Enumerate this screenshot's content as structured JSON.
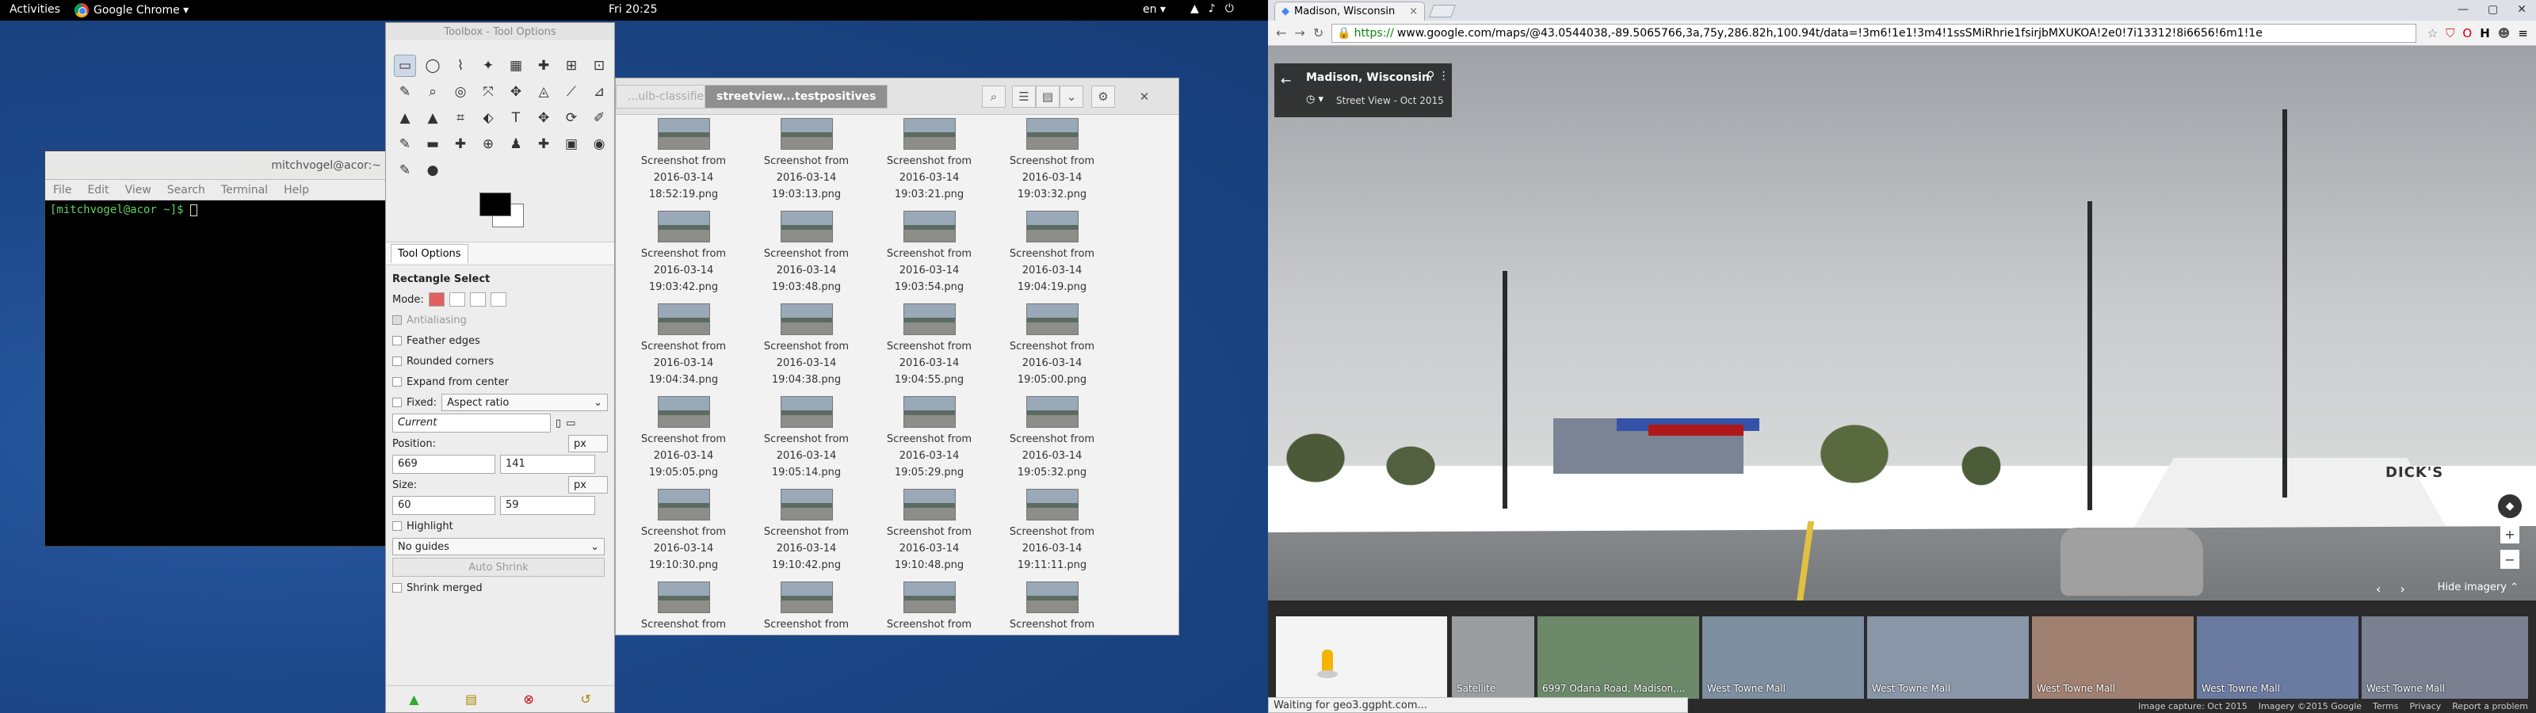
{
  "topbar": {
    "activities": "Activities",
    "app": "Google Chrome ▾",
    "clock": "Fri 20:25",
    "lang": "en ▾",
    "tray_icons": [
      "▲",
      "♪",
      "⏻"
    ]
  },
  "terminal": {
    "title": "mitchvogel@acor:~",
    "menu": [
      "File",
      "Edit",
      "View",
      "Search",
      "Terminal",
      "Help"
    ],
    "prompt": "[mitchvogel@acor ~]$ "
  },
  "toolbox": {
    "title": "Toolbox - Tool Options",
    "tools": [
      "▭",
      "◯",
      "⌇",
      "✦",
      "▦",
      "✚",
      "⊞",
      "⊡",
      "✎",
      "⌕",
      "◎",
      "⤧",
      "✥",
      "◬",
      "⟋",
      "⊿",
      "▲",
      "▲",
      "⌗",
      "⬖",
      "T",
      "✥",
      "⟳",
      "✐",
      "✎",
      "▬",
      "✚",
      "⊕",
      "♟",
      "✚",
      "▣",
      "◉",
      "✎",
      "●"
    ],
    "tab_label": "Tool Options",
    "tool_name": "Rectangle Select",
    "mode_label": "Mode:",
    "antialiasing": "Antialiasing",
    "feather": "Feather edges",
    "rounded": "Rounded corners",
    "expand": "Expand from center",
    "fixed": "Fixed:",
    "fixed_value": "Aspect ratio",
    "current": "Current",
    "position_label": "Position:",
    "unit": "px",
    "pos_x": "669",
    "pos_y": "141",
    "size_label": "Size:",
    "size_w": "60",
    "size_h": "59",
    "highlight": "Highlight",
    "guides": "No guides",
    "auto_shrink": "Auto Shrink",
    "shrink_merged": "Shrink merged"
  },
  "files": {
    "crumb_prev": "...ulb-classifier",
    "crumb_active": "streetview...testpositives",
    "items": [
      {
        "l1": "Screenshot from",
        "l2": "2016-03-14",
        "l3": "18:52:19.png"
      },
      {
        "l1": "Screenshot from",
        "l2": "2016-03-14",
        "l3": "19:03:13.png"
      },
      {
        "l1": "Screenshot from",
        "l2": "2016-03-14",
        "l3": "19:03:21.png"
      },
      {
        "l1": "Screenshot from",
        "l2": "2016-03-14",
        "l3": "19:03:32.png"
      },
      {
        "l1": "Screenshot from",
        "l2": "2016-03-14",
        "l3": "19:03:42.png"
      },
      {
        "l1": "Screenshot from",
        "l2": "2016-03-14",
        "l3": "19:03:48.png"
      },
      {
        "l1": "Screenshot from",
        "l2": "2016-03-14",
        "l3": "19:03:54.png"
      },
      {
        "l1": "Screenshot from",
        "l2": "2016-03-14",
        "l3": "19:04:19.png"
      },
      {
        "l1": "Screenshot from",
        "l2": "2016-03-14",
        "l3": "19:04:34.png"
      },
      {
        "l1": "Screenshot from",
        "l2": "2016-03-14",
        "l3": "19:04:38.png"
      },
      {
        "l1": "Screenshot from",
        "l2": "2016-03-14",
        "l3": "19:04:55.png"
      },
      {
        "l1": "Screenshot from",
        "l2": "2016-03-14",
        "l3": "19:05:00.png"
      },
      {
        "l1": "Screenshot from",
        "l2": "2016-03-14",
        "l3": "19:05:05.png"
      },
      {
        "l1": "Screenshot from",
        "l2": "2016-03-14",
        "l3": "19:05:14.png"
      },
      {
        "l1": "Screenshot from",
        "l2": "2016-03-14",
        "l3": "19:05:29.png"
      },
      {
        "l1": "Screenshot from",
        "l2": "2016-03-14",
        "l3": "19:05:32.png"
      },
      {
        "l1": "Screenshot from",
        "l2": "2016-03-14",
        "l3": "19:10:30.png"
      },
      {
        "l1": "Screenshot from",
        "l2": "2016-03-14",
        "l3": "19:10:42.png"
      },
      {
        "l1": "Screenshot from",
        "l2": "2016-03-14",
        "l3": "19:10:48.png"
      },
      {
        "l1": "Screenshot from",
        "l2": "2016-03-14",
        "l3": "19:11:11.png"
      },
      {
        "l1": "Screenshot from",
        "l2": "",
        "l3": ""
      },
      {
        "l1": "Screenshot from",
        "l2": "",
        "l3": ""
      },
      {
        "l1": "Screenshot from",
        "l2": "",
        "l3": ""
      },
      {
        "l1": "Screenshot from",
        "l2": "",
        "l3": ""
      }
    ]
  },
  "browser": {
    "tab_title": "Madison, Wisconsin",
    "url_scheme": "https://",
    "url_rest": "www.google.com/maps/@43.0544038,-89.5065766,3a,75y,286.82h,100.94t/data=!3m6!1e1!3m4!1ssSMiRhrie1fsirjbMXUKOA!2e0!7i13312!8i6656!6m1!1e",
    "location": "Madison, Wisconsin",
    "date": "Street View - Oct 2015",
    "hide_imagery": "Hide imagery ⌃",
    "store_sign": "DICK'S",
    "cards": [
      {
        "label": ""
      },
      {
        "label": "Satellite"
      },
      {
        "label": "6997 Odana Road, Madison,..."
      },
      {
        "label": "West Towne Mall"
      },
      {
        "label": "West Towne Mall"
      },
      {
        "label": "West Towne Mall"
      },
      {
        "label": "West Towne Mall"
      },
      {
        "label": "West Towne Mall"
      }
    ],
    "status": "Waiting for geo3.ggpht.com...",
    "footer": [
      "Imagery ©2015 Google",
      "Terms",
      "Privacy",
      "Report a problem"
    ],
    "footer_date": "Image capture: Oct 2015"
  }
}
